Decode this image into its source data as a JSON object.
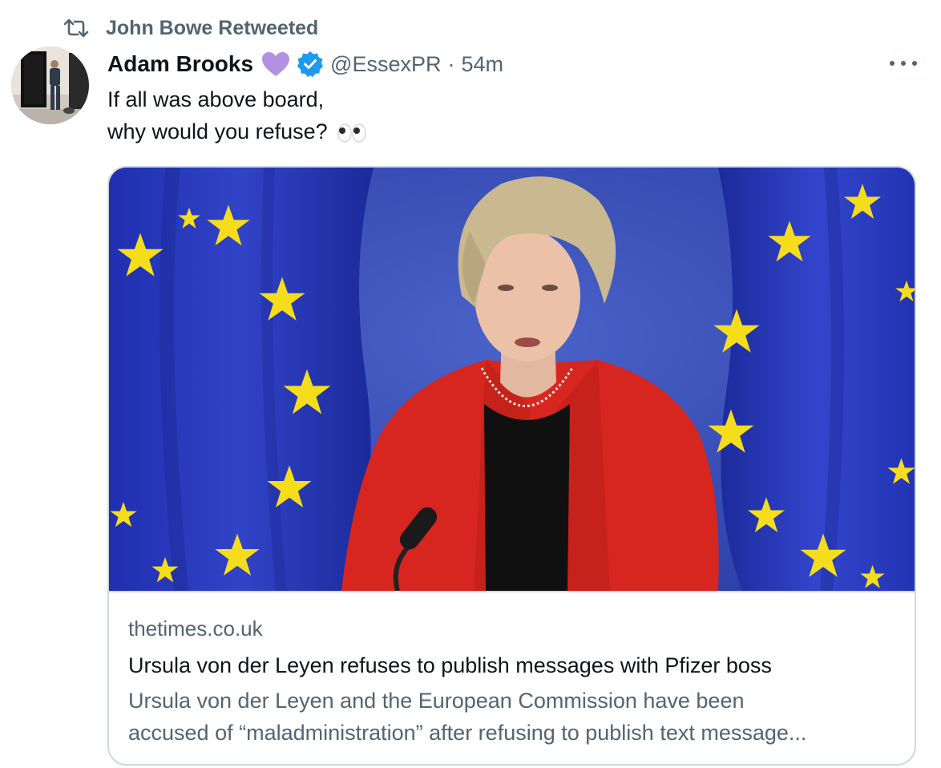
{
  "retweet": {
    "icon": "retweet-icon",
    "label": "John Bowe Retweeted"
  },
  "author": {
    "display_name": "Adam Brooks",
    "emoji": "purple-heart-icon",
    "verified_icon": "verified-badge-icon",
    "handle": "@EssexPR",
    "separator": "·",
    "time": "54m"
  },
  "tweet": {
    "line1": "If all was above board,",
    "line2": "why would you refuse?",
    "emoji": "eyes-icon"
  },
  "card": {
    "image": "eu-flag-speaker-photo",
    "domain": "thetimes.co.uk",
    "title": "Ursula von der Leyen refuses to publish messages with Pfizer boss",
    "description_line1": "Ursula von der Leyen and the European Commission have been",
    "description_line2": "accused of “maladministration” after refusing to publish text message..."
  },
  "colors": {
    "text_primary": "#0f1419",
    "text_secondary": "#536471",
    "verified_blue": "#1d9bf0",
    "heart_purple": "#b191e0",
    "border": "#cfd9de"
  }
}
